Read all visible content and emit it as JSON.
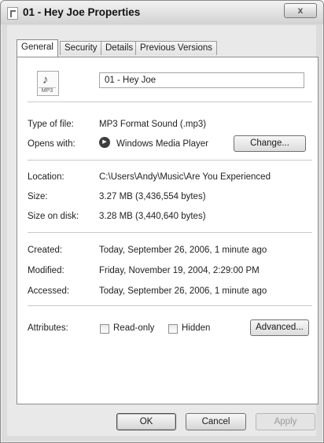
{
  "window": {
    "title": "01 - Hey Joe Properties",
    "close_label": "x"
  },
  "tabs": [
    {
      "label": "General",
      "active": true
    },
    {
      "label": "Security",
      "active": false
    },
    {
      "label": "Details",
      "active": false
    },
    {
      "label": "Previous Versions",
      "active": false
    }
  ],
  "file": {
    "icon": "mp3-file-icon",
    "icon_tag": "MP3",
    "name": "01 - Hey Joe"
  },
  "type": {
    "label": "Type of file:",
    "value": "MP3 Format Sound (.mp3)"
  },
  "opens_with": {
    "label": "Opens with:",
    "app_icon": "windows-media-player-icon",
    "value": "Windows Media Player",
    "change_label": "Change..."
  },
  "location": {
    "label": "Location:",
    "value": "C:\\Users\\Andy\\Music\\Are You Experienced"
  },
  "size": {
    "label": "Size:",
    "value": "3.27 MB (3,436,554 bytes)"
  },
  "size_on_disk": {
    "label": "Size on disk:",
    "value": "3.28 MB (3,440,640 bytes)"
  },
  "created": {
    "label": "Created:",
    "value": "Today, September 26, 2006, 1 minute ago"
  },
  "modified": {
    "label": "Modified:",
    "value": "Friday, November 19, 2004, 2:29:00 PM"
  },
  "accessed": {
    "label": "Accessed:",
    "value": "Today, September 26, 2006, 1 minute ago"
  },
  "attributes": {
    "label": "Attributes:",
    "readonly_label": "Read-only",
    "readonly_checked": false,
    "hidden_label": "Hidden",
    "hidden_checked": false,
    "advanced_label": "Advanced..."
  },
  "buttons": {
    "ok": "OK",
    "cancel": "Cancel",
    "apply": "Apply"
  }
}
